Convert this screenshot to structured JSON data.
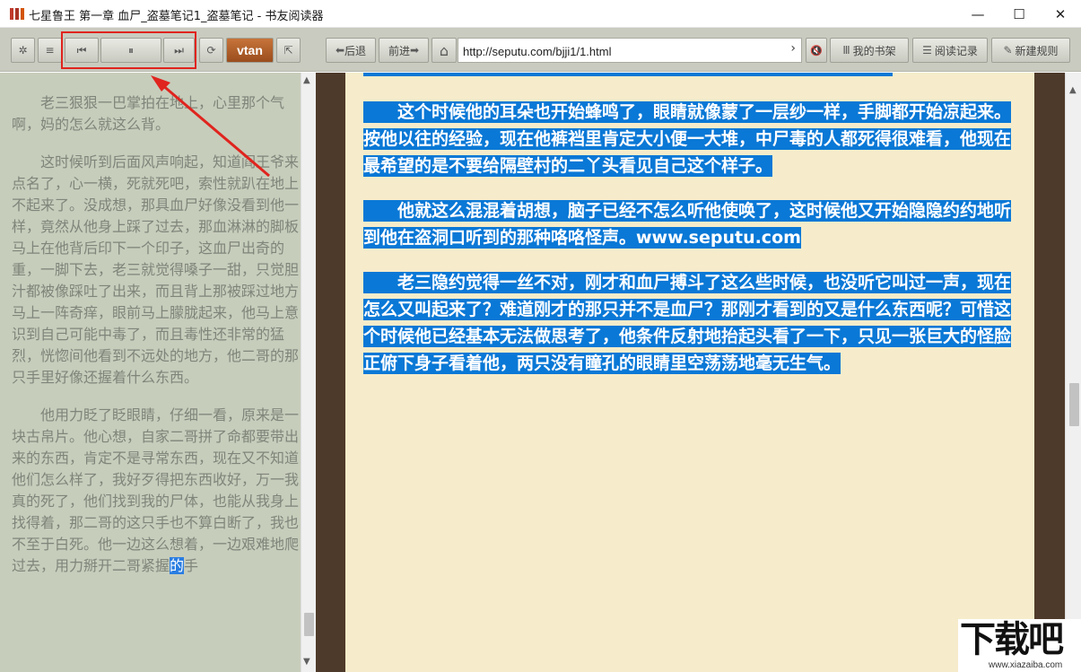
{
  "window": {
    "title": "七星鲁王 第一章 血尸_盗墓笔记1_盗墓笔记 - 书友阅读器",
    "minimize": "—",
    "maximize": "☐",
    "close": "✕"
  },
  "toolbar": {
    "settings_glyph": "✲",
    "menu_glyph": "≡",
    "prev_glyph": "⏮",
    "pause_glyph": "⏸",
    "next_glyph": "⏭",
    "refresh_glyph": "⟳",
    "vtan_label": "vtan",
    "export_glyph": "⇱",
    "back_label": "后退",
    "back_glyph": "⬅",
    "forward_label": "前进",
    "forward_glyph": "➡",
    "home_glyph": "⌂",
    "url": "http://seputu.com/bjji1/1.html",
    "go_glyph": "›",
    "mute_glyph": "🔇",
    "bookshelf_label": "我的书架",
    "history_label": "阅读记录",
    "new_rule_label": "新建规则"
  },
  "left_pane": {
    "paragraphs": [
      "老三狠狠一巴掌拍在地上，心里那个气啊，妈的怎么就这么背。",
      "这时候听到后面风声响起，知道阎王爷来点名了，心一横，死就死吧，索性就趴在地上不起来了。没成想，那具血尸好像没看到他一样，竟然从他身上踩了过去，那血淋淋的脚板马上在他背后印下一个印子，这血尸出奇的重，一脚下去，老三就觉得嗓子一甜，只觉胆汁都被像踩吐了出来，而且背上那被踩过地方马上一阵奇痒，眼前马上朦胧起来，他马上意识到自己可能中毒了，而且毒性还非常的猛烈，恍惚间他看到不远处的地方，他二哥的那只手里好像还握着什么东西。"
    ],
    "last_paragraph_before": "他用力眨了眨眼睛，仔细一看，原来是一块古帛片。他心想，自家二哥拼了命都要带出来的东西，肯定不是寻常东西，现在又不知道他们怎么样了，我好歹得把东西收好，万一我真的死了，他们找到我的尸体，也能从我身上找得着，那二哥的这只手也不算白断了，我也不至于白死。他一边这么想着，一边艰难地爬过去，用力掰开二哥紧握",
    "last_paragraph_selected": "的",
    "last_paragraph_after": "手"
  },
  "reader": {
    "paragraphs": [
      "这个时候他的耳朵也开始蜂鸣了，眼睛就像蒙了一层纱一样，手脚都开始凉起来。按他以往的经验，现在他裤裆里肯定大小便一大堆，中尸毒的人都死得很难看，他现在最希望的是不要给隔壁村的二丫头看见自己这个样子。",
      "他就这么混混着胡想，脑子已经不怎么听他使唤了，这时候他又开始隐隐约约地听到他在盗洞口听到的那种咯咯怪声。www.seputu.com",
      "老三隐约觉得一丝不对，刚才和血尸搏斗了这么些时候，也没听它叫过一声，现在怎么又叫起来了？难道刚才的那只并不是血尸？那刚才看到的又是什么东西呢？可惜这个时候他已经基本无法做思考了，他条件反射地抬起头看了一下，只见一张巨大的怪脸正俯下身子看着他，两只没有瞳孔的眼睛里空荡荡地毫无生气。"
    ]
  },
  "scrollbar": {
    "up_glyph": "▲",
    "down_glyph": "▼"
  },
  "watermark": {
    "logo_text": "下载吧",
    "site": "www.xiazaiba.com"
  }
}
